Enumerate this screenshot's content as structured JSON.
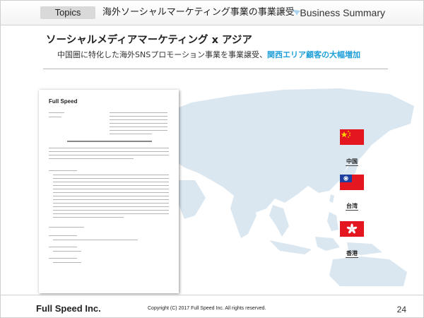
{
  "header": {
    "topics_label": "Topics",
    "title": "海外ソーシャルマーケティング事業の事業譲受",
    "section": "Business Summary"
  },
  "main": {
    "title": "ソーシャルメディアマーケティング x アジア",
    "subtitle_plain": "中国圏に特化した海外SNSプロモーション事業を事業譲受、",
    "subtitle_highlight": "関西エリア顧客の大幅増加"
  },
  "document": {
    "logo": "Full Speed"
  },
  "flags": [
    {
      "label": "中国",
      "icon": "china-flag-icon"
    },
    {
      "label": "台湾",
      "icon": "taiwan-flag-icon"
    },
    {
      "label": "香港",
      "icon": "hongkong-flag-icon"
    }
  ],
  "footer": {
    "company": "Full Speed Inc.",
    "copyright": "Copyright (C) 2017 Full Speed Inc. All rights reserved.",
    "page_number": "24"
  },
  "colors": {
    "accent": "#1f9fd8",
    "map": "#dbe7f0"
  }
}
